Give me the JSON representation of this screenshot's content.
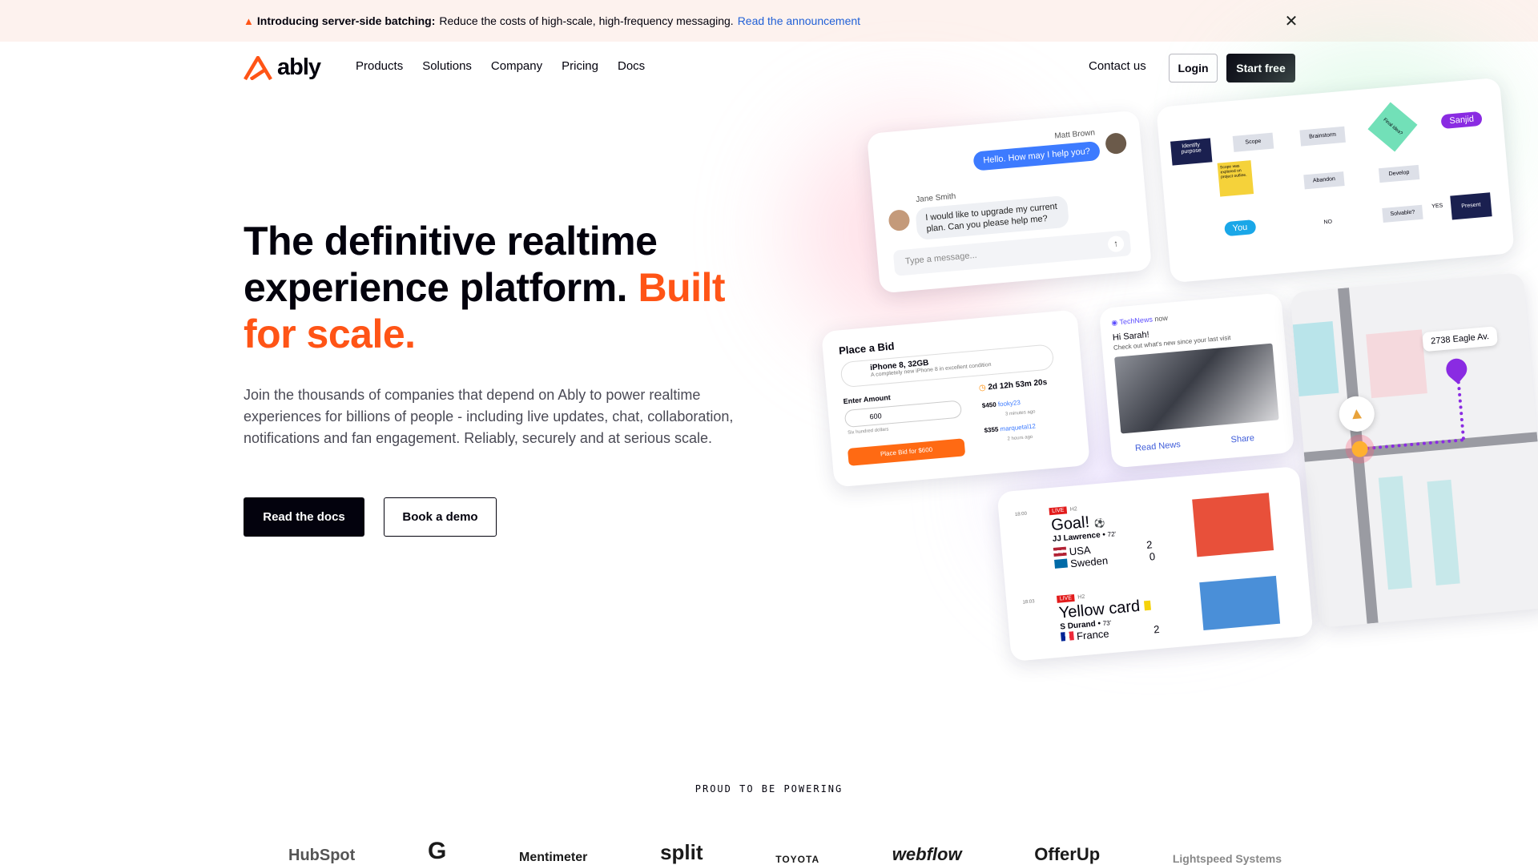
{
  "banner": {
    "bold": "Introducing server-side batching:",
    "text": "Reduce the costs of high-scale, high-frequency messaging.",
    "link": "Read the announcement",
    "close_icon": "close-icon"
  },
  "brand": {
    "name": "ably",
    "accent": "#ff5416",
    "dark": "#03020d"
  },
  "nav": {
    "items": [
      "Products",
      "Solutions",
      "Company",
      "Pricing",
      "Docs"
    ],
    "contact": "Contact us",
    "login": "Login",
    "start": "Start free"
  },
  "hero": {
    "title_main": "The definitive realtime experience platform.",
    "title_accent": "Built for scale.",
    "subtitle": "Join the thousands of companies that depend on Ably to power realtime experiences for billions of people - including live updates, chat, collaboration, notifications and fan engagement. Reliably, securely and at serious scale.",
    "btn_docs": "Read the docs",
    "btn_demo": "Book a demo"
  },
  "chat": {
    "agent": "Matt Brown",
    "agent_msg": "Hello. How may I help you?",
    "user": "Jane Smith",
    "user_msg": "I would like to upgrade my current plan. Can you please help me?",
    "placeholder": "Type a message..."
  },
  "flow": {
    "nodes": [
      "Identify purpose",
      "Scope",
      "Brainstorm",
      "Final idea?",
      "Abandon",
      "Develop",
      "Solvable?",
      "Present"
    ],
    "labels": [
      "NO",
      "YES"
    ],
    "sticky": "Scope was explored on project outline.",
    "cursor_1": "Sanjid",
    "cursor_2": "You"
  },
  "bid": {
    "title": "Place a Bid",
    "product": "iPhone 8, 32GB",
    "product_desc": "A completely new iPhone 8 in excellent condition",
    "amount_label": "Enter Amount",
    "timer": "2d 12h 53m 20s",
    "amount": "600",
    "amount_words": "Six hundred dollars",
    "button": "Place Bid for $600",
    "bids": [
      {
        "amount": "$450",
        "user": "fooky23",
        "time": "3 minutes ago"
      },
      {
        "amount": "$355",
        "user": "marquetal12",
        "time": "2 hours ago"
      }
    ]
  },
  "news": {
    "source": "TechNews",
    "time": "now",
    "greeting": "Hi Sarah!",
    "message": "Check out what's new since your last visit",
    "read": "Read News",
    "share": "Share"
  },
  "map": {
    "address": "2738 Eagle Av."
  },
  "score": {
    "events": [
      {
        "time": "18:00",
        "badge": "LIVE",
        "half": "H2",
        "title": "Goal!",
        "player": "JJ Lawrence",
        "minute": "72'",
        "team1": "USA",
        "score1": "2",
        "team2": "Sweden",
        "score2": "0"
      },
      {
        "time": "18:03",
        "badge": "LIVE",
        "half": "H2",
        "title": "Yellow card",
        "player": "S Durand",
        "minute": "73'",
        "team1": "France",
        "score1": "2"
      }
    ]
  },
  "powering": {
    "heading": "PROUD TO BE POWERING",
    "logos": [
      "HubSpot",
      "G",
      "Mentimeter",
      "split",
      "TOYOTA",
      "webflow",
      "OfferUp",
      "Lightspeed Systems"
    ]
  }
}
